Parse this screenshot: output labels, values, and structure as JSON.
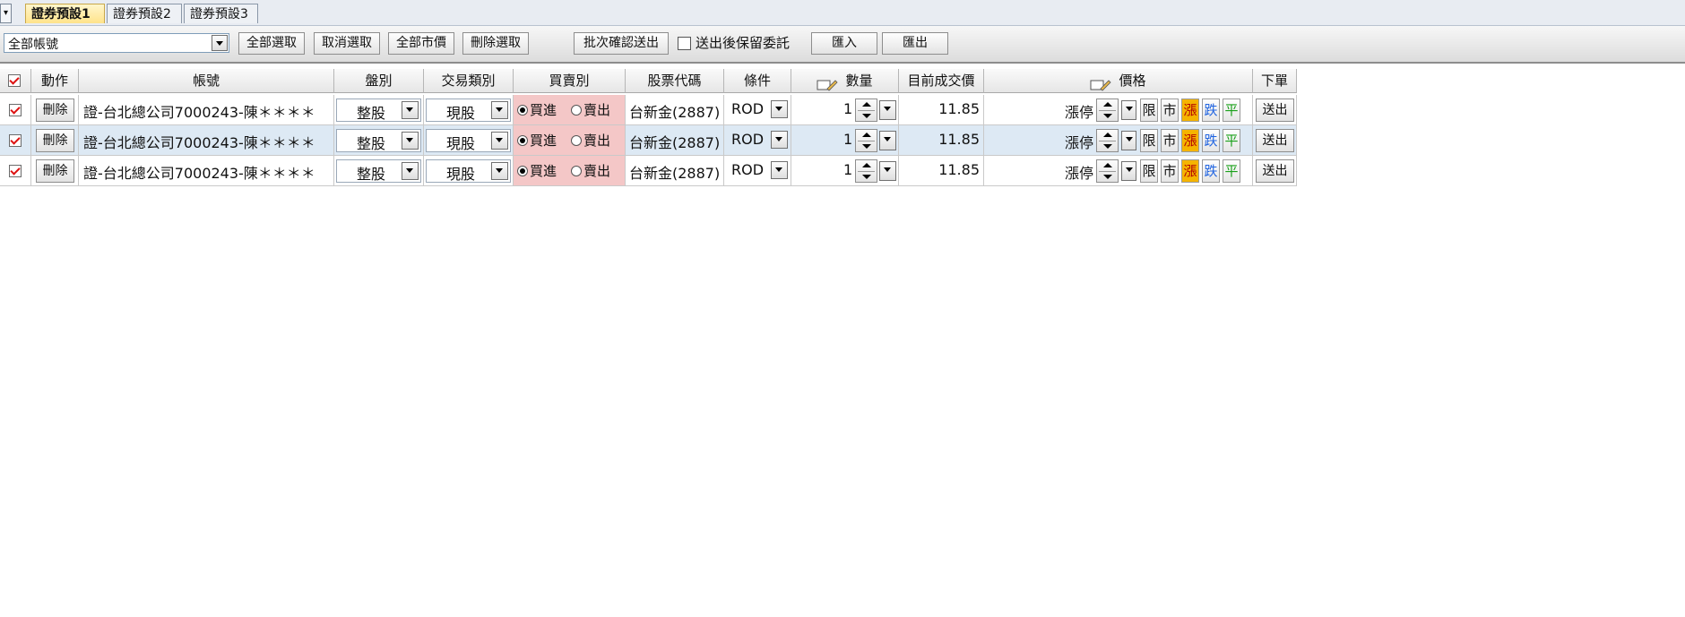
{
  "tabs": [
    {
      "label": "證券預設1",
      "active": true
    },
    {
      "label": "證券預設2",
      "active": false
    },
    {
      "label": "證券預設3",
      "active": false
    }
  ],
  "toolbar": {
    "account_select_value": "全部帳號",
    "select_all_label": "全部選取",
    "cancel_select_label": "取消選取",
    "all_market_label": "全部市價",
    "delete_selected_label": "刪除選取",
    "batch_send_label": "批次確認送出",
    "keep_order_label": "送出後保留委託",
    "keep_order_checked": false,
    "import_label": "匯入",
    "export_label": "匯出"
  },
  "grid": {
    "headers": {
      "action": "動作",
      "account": "帳號",
      "market": "盤別",
      "trade_type": "交易類別",
      "side": "買賣別",
      "stock_code": "股票代碼",
      "condition": "條件",
      "quantity": "數量",
      "last_price": "目前成交價",
      "price": "價格",
      "order": "下單"
    },
    "rows": [
      {
        "checked": true,
        "delete_label": "刪除",
        "account": "證-台北總公司7000243-陳＊＊＊＊",
        "market": "整股",
        "trade_type": "現股",
        "buy_label": "買進",
        "sell_label": "賣出",
        "side_selected": "buy",
        "stock": "台新金(2887)",
        "condition": "ROD",
        "quantity": "1",
        "last_price": "11.85",
        "price": "漲停",
        "limit_label": "限",
        "market_label": "市",
        "up_label": "漲",
        "down_label": "跌",
        "flat_label": "平",
        "send_label": "送出"
      },
      {
        "checked": true,
        "delete_label": "刪除",
        "account": "證-台北總公司7000243-陳＊＊＊＊",
        "market": "整股",
        "trade_type": "現股",
        "buy_label": "買進",
        "sell_label": "賣出",
        "side_selected": "buy",
        "stock": "台新金(2887)",
        "condition": "ROD",
        "quantity": "1",
        "last_price": "11.85",
        "price": "漲停",
        "limit_label": "限",
        "market_label": "市",
        "up_label": "漲",
        "down_label": "跌",
        "flat_label": "平",
        "send_label": "送出"
      },
      {
        "checked": true,
        "delete_label": "刪除",
        "account": "證-台北總公司7000243-陳＊＊＊＊",
        "market": "整股",
        "trade_type": "現股",
        "buy_label": "買進",
        "sell_label": "賣出",
        "side_selected": "buy",
        "stock": "台新金(2887)",
        "condition": "ROD",
        "quantity": "1",
        "last_price": "11.85",
        "price": "漲停",
        "limit_label": "限",
        "market_label": "市",
        "up_label": "漲",
        "down_label": "跌",
        "flat_label": "平",
        "send_label": "送出"
      }
    ]
  },
  "colors": {
    "side_column_bg": "#f4c7c7",
    "alt_row_bg": "#dde9f4",
    "up_button_bg": "#f5b400",
    "up_text": "#b30000",
    "down_text": "#1f63e0",
    "flat_text": "#19a019",
    "check_mark": "#dd1111"
  }
}
